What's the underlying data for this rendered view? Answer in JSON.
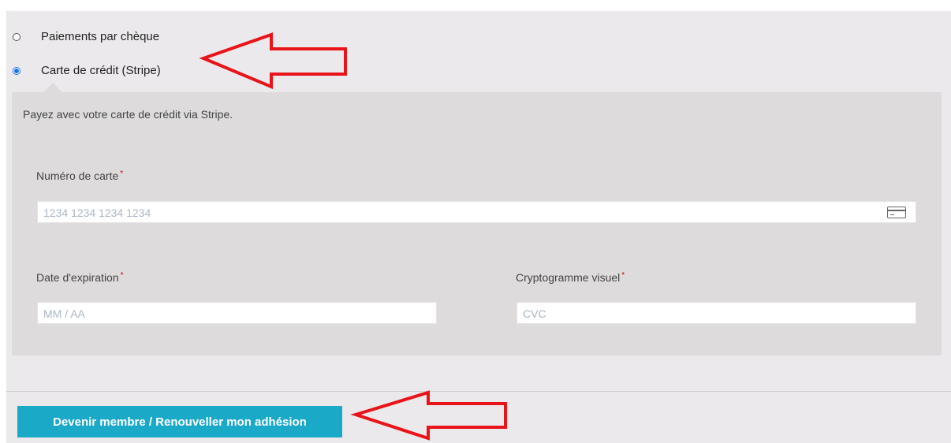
{
  "payment_methods": [
    {
      "label": "Paiements par chèque",
      "selected": false
    },
    {
      "label": "Carte de crédit (Stripe)",
      "selected": true
    }
  ],
  "stripe": {
    "description": "Payez avec votre carte de crédit via Stripe.",
    "card_number": {
      "label": "Numéro de carte",
      "required_mark": "*",
      "placeholder": "1234 1234 1234 1234",
      "icon": "credit-card-icon"
    },
    "expiry": {
      "label": "Date d'expiration",
      "required_mark": "*",
      "placeholder": "MM / AA"
    },
    "cvc": {
      "label": "Cryptogramme visuel",
      "required_mark": "*",
      "placeholder": "CVC"
    }
  },
  "submit": {
    "label": "Devenir membre / Renouveller mon adhésion"
  },
  "colors": {
    "accent": "#1aa9c7",
    "arrow": "#e8141a",
    "radio_selected": "#1a73e8"
  }
}
